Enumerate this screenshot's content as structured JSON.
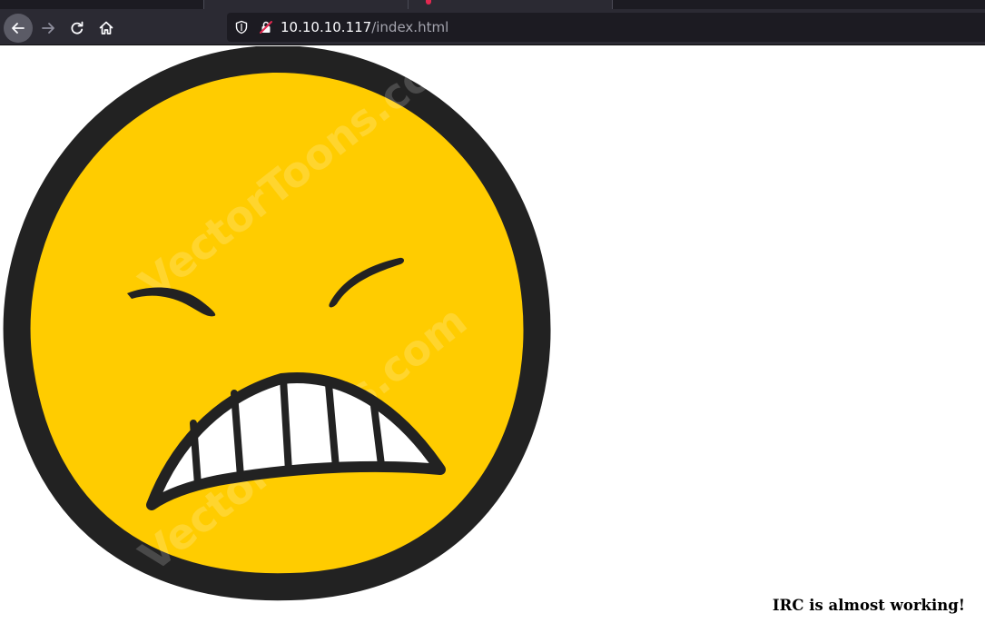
{
  "browser": {
    "url_host": "10.10.10.117",
    "url_path": "/index.html",
    "icons": {
      "back": "arrow-left-icon",
      "forward": "arrow-right-icon",
      "reload": "reload-icon",
      "home": "home-icon",
      "tracking": "shield-icon",
      "insecure": "insecure-lock-icon"
    }
  },
  "page": {
    "image": {
      "subject": "angry-face-icon",
      "face_color": "#ffcc00",
      "outline_color": "#222222",
      "watermark": "VectorToons.com"
    },
    "status_heading": "IRC is almost working!"
  },
  "colors": {
    "chrome_bg": "#2b2a33",
    "urlbar_bg": "#1c1b22",
    "page_bg": "#ffffff"
  }
}
